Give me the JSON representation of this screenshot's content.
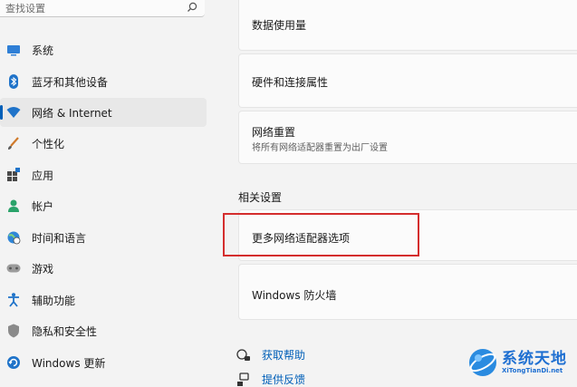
{
  "search": {
    "placeholder": "查找设置"
  },
  "sidebar": {
    "items": [
      {
        "label": "系统",
        "icon": "system-icon"
      },
      {
        "label": "蓝牙和其他设备",
        "icon": "bluetooth-icon"
      },
      {
        "label": "网络 & Internet",
        "icon": "wifi-icon",
        "active": true
      },
      {
        "label": "个性化",
        "icon": "brush-icon"
      },
      {
        "label": "应用",
        "icon": "apps-icon"
      },
      {
        "label": "帐户",
        "icon": "account-icon"
      },
      {
        "label": "时间和语言",
        "icon": "globe-clock-icon"
      },
      {
        "label": "游戏",
        "icon": "gamepad-icon"
      },
      {
        "label": "辅助功能",
        "icon": "accessibility-icon"
      },
      {
        "label": "隐私和安全性",
        "icon": "shield-icon"
      },
      {
        "label": "Windows 更新",
        "icon": "update-icon"
      }
    ]
  },
  "main": {
    "cards": [
      {
        "title": "数据使用量"
      },
      {
        "title": "硬件和连接属性"
      },
      {
        "title": "网络重置",
        "subtitle": "将所有网络适配器重置为出厂设置"
      }
    ],
    "related_title": "相关设置",
    "related": [
      {
        "title": "更多网络适配器选项"
      },
      {
        "title": "Windows 防火墙"
      }
    ],
    "help": [
      {
        "label": "获取帮助",
        "icon": "help-icon"
      },
      {
        "label": "提供反馈",
        "icon": "feedback-icon"
      }
    ]
  },
  "watermark": {
    "main": "系统天地",
    "sub": "XiTongTianDi.net"
  },
  "colors": {
    "accent": "#005fb8",
    "highlight": "#d42d2d"
  }
}
